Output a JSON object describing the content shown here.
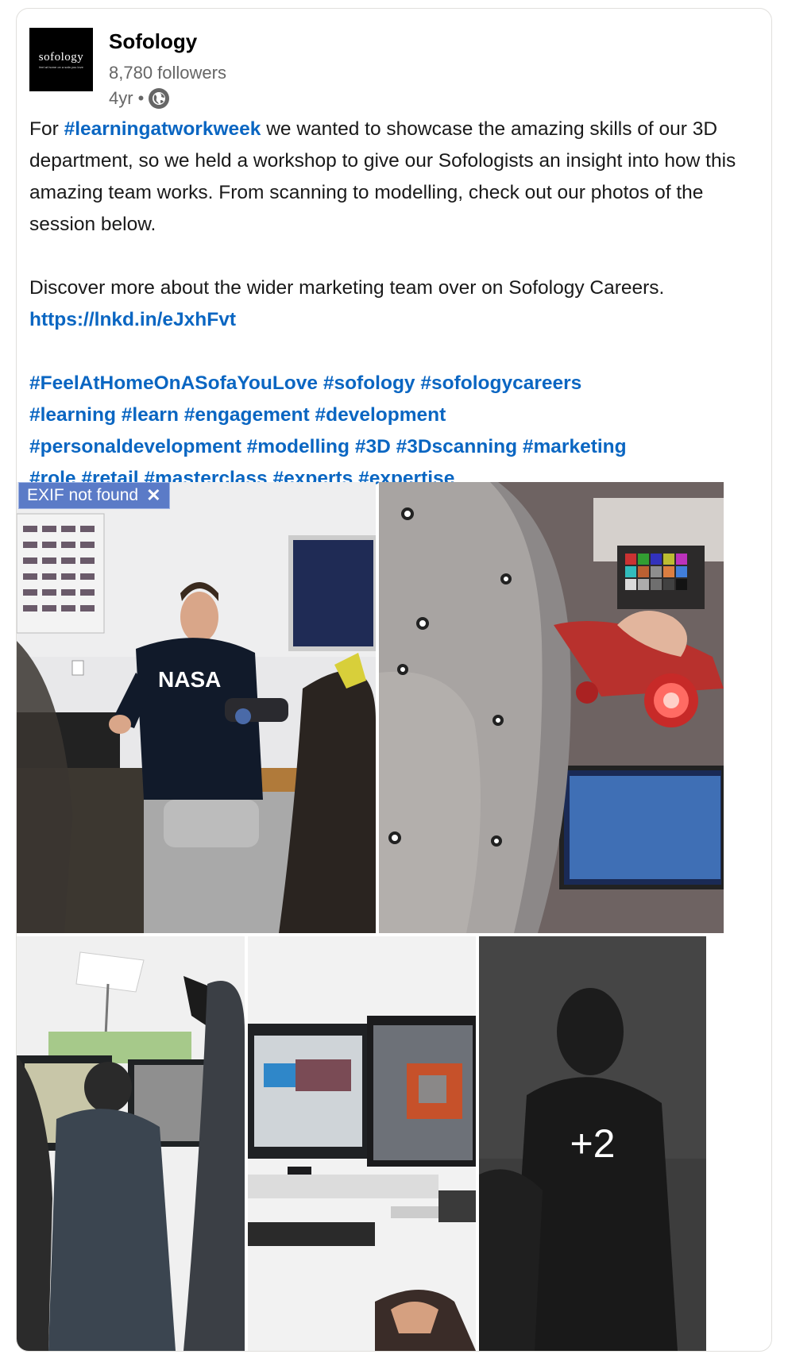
{
  "post": {
    "company_name": "Sofology",
    "logo": {
      "brand": "sofology",
      "tagline": "feel at home on a sofa you love"
    },
    "followers": "8,780 followers",
    "age": "4yr •",
    "visibility_icon": "globe-icon",
    "text": {
      "p1_prefix": "For ",
      "p1_hashtag": "#learningatworkweek",
      "p1_rest": " we wanted to showcase the amazing skills of our 3D department, so we held a workshop to give our Sofologists an insight into how this amazing team works. From scanning to modelling, check out our photos of the session below.",
      "p2_text": "Discover more about the wider marketing team over on Sofology Careers. ",
      "p2_link": "https://lnkd.in/eJxhFvt",
      "hashtags": [
        "#FeelAtHomeOnASofaYouLove",
        "#sofology",
        "#sofologycareers",
        "#learning",
        "#learn",
        "#engagement",
        "#development",
        "#personaldevelopment",
        "#modelling",
        "#3D",
        "#3Dscanning",
        "#marketing",
        "#role",
        "#retail",
        "#masterclass",
        "#experts",
        "#expertise"
      ]
    },
    "media": {
      "exif_label": "EXIF not found",
      "exif_close": "✕",
      "more_count": "+2"
    }
  },
  "colors": {
    "link": "#0a66c2",
    "meta": "#666666",
    "exif_bg": "#5b7bc7"
  }
}
